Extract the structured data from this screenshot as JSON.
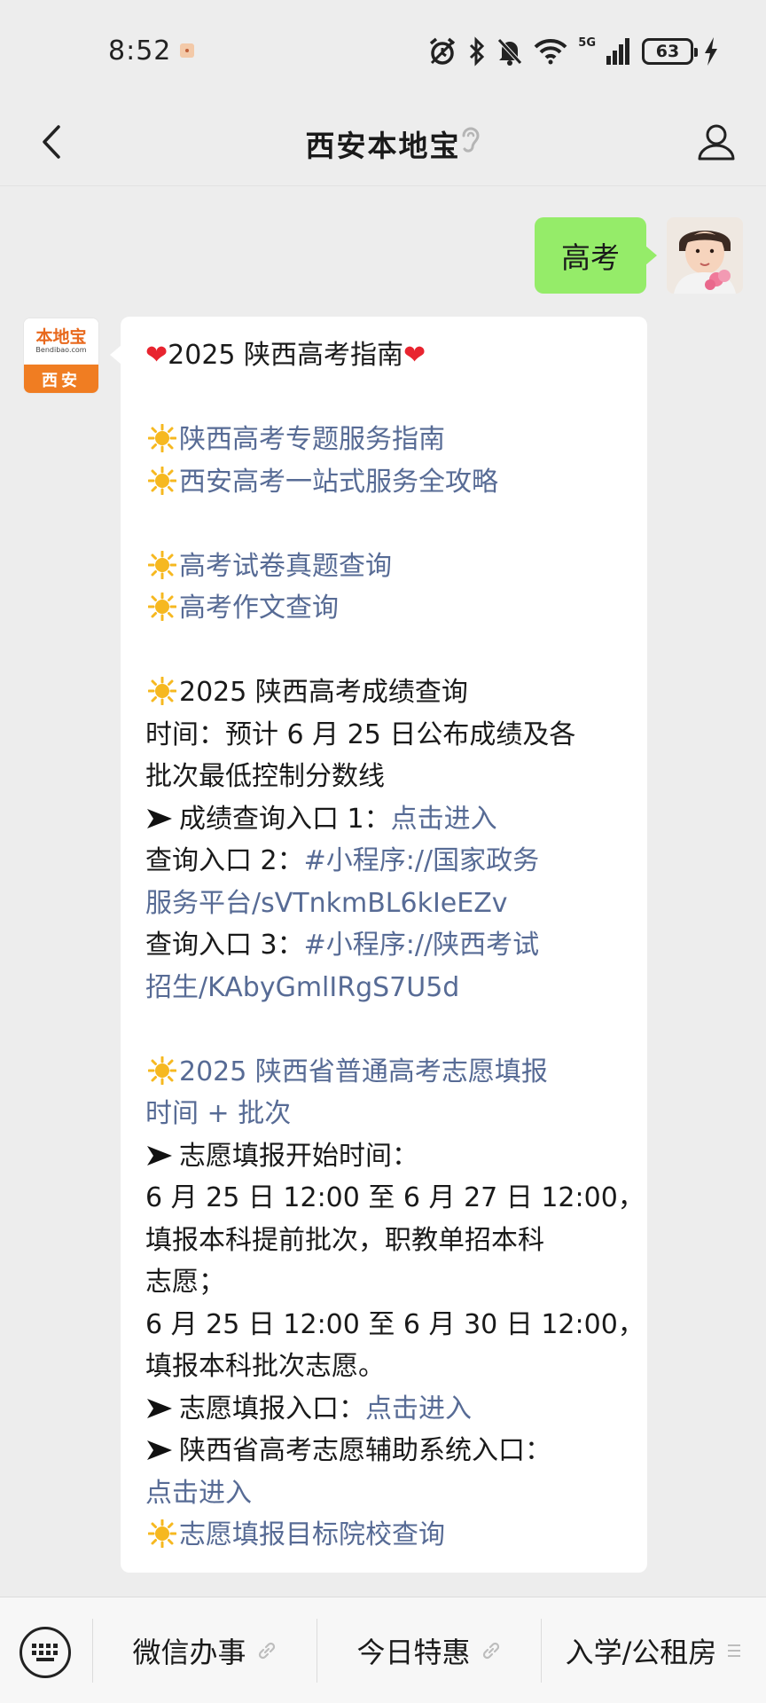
{
  "status_bar": {
    "time": "8:52",
    "network": "5G",
    "battery": "63",
    "icons": [
      "alarm-icon",
      "bluetooth-icon",
      "mute-icon",
      "wifi-icon",
      "signal-icon",
      "battery-icon",
      "charging-icon"
    ]
  },
  "nav": {
    "title": "西安本地宝",
    "icons": [
      "back-icon",
      "ear-icon",
      "profile-icon"
    ]
  },
  "chat": {
    "user_message": "高考",
    "bot_avatar": {
      "logo": "本地宝",
      "site": "Bendibao.com",
      "city": "西安"
    },
    "bot_message": {
      "title": "2025 陕西高考指南",
      "guide_links": [
        "陕西高考专题服务指南",
        "西安高考一站式服务全攻略"
      ],
      "exam_links": [
        "高考试卷真题查询",
        "高考作文查询"
      ],
      "score": {
        "heading": "2025 陕西高考成绩查询",
        "time_line1": "时间：预计 6 月 25 日公布成绩及各",
        "time_line2": "批次最低控制分数线",
        "entry1_label": "成绩查询入口 1：",
        "entry1_link": "点击进入",
        "entry2_label": "查询入口 2：",
        "entry2_link_line1": "#小程序://国家政务",
        "entry2_link_line2": "服务平台/sVTnkmBL6kIeEZv",
        "entry3_label": "查询入口 3：",
        "entry3_link_line1": "#小程序://陕西考试",
        "entry3_link_line2": "招生/KAbyGmlIRgS7U5d"
      },
      "volunteer": {
        "heading_line1": "2025 陕西省普通高考志愿填报",
        "heading_line2": "时间 + 批次",
        "start_label": "志愿填报开始时间：",
        "period1": "6 月 25 日 12:00 至 6 月 27 日 12:00，",
        "period1_desc1": "填报本科提前批次，职教单招本科",
        "period1_desc2": "志愿；",
        "period2": "6 月 25 日 12:00 至 6 月 30 日 12:00，",
        "period2_desc": "填报本科批次志愿。",
        "entry_label": "志愿填报入口：",
        "entry_link": "点击进入",
        "aux_label": "陕西省高考志愿辅助系统入口：",
        "aux_link": "点击进入",
        "target_link": "志愿填报目标院校查询"
      }
    }
  },
  "bottom_menu": {
    "items": [
      "微信办事",
      "今日特惠",
      "入学/公租房"
    ],
    "icons": [
      "keyboard-icon",
      "link-icon",
      "link-icon",
      "menu-list-icon"
    ]
  },
  "colors": {
    "background": "#ededed",
    "user_bubble": "#95ec69",
    "link": "#576b95",
    "heart": "#e8242f",
    "sun": "#f6b820"
  }
}
